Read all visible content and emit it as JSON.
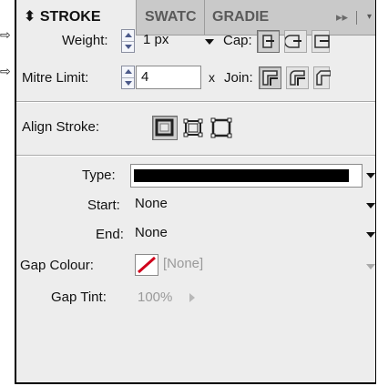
{
  "panel": {
    "tabs": [
      {
        "label": "⬍ STROKE"
      },
      {
        "label": "SWATC"
      },
      {
        "label": "GRADIE"
      }
    ],
    "menu_glyph": "▸▸",
    "flyout_glyph": "▾"
  },
  "side_markers": [
    "⇨",
    "⇨"
  ],
  "weight": {
    "label": "Weight:",
    "value": "1 px"
  },
  "cap": {
    "label": "Cap:"
  },
  "mitre": {
    "label": "Mitre Limit:",
    "value": "4",
    "suffix": "x"
  },
  "join": {
    "label": "Join:"
  },
  "align": {
    "label": "Align Stroke:"
  },
  "type": {
    "label": "Type:",
    "swatch_color": "#000000"
  },
  "start": {
    "label": "Start:",
    "value": "None"
  },
  "end": {
    "label": "End:",
    "value": "None"
  },
  "gap_colour": {
    "label": "Gap Colour:",
    "value": "[None]",
    "none_color": "#d0021b"
  },
  "gap_tint": {
    "label": "Gap Tint:",
    "value": "100%"
  }
}
